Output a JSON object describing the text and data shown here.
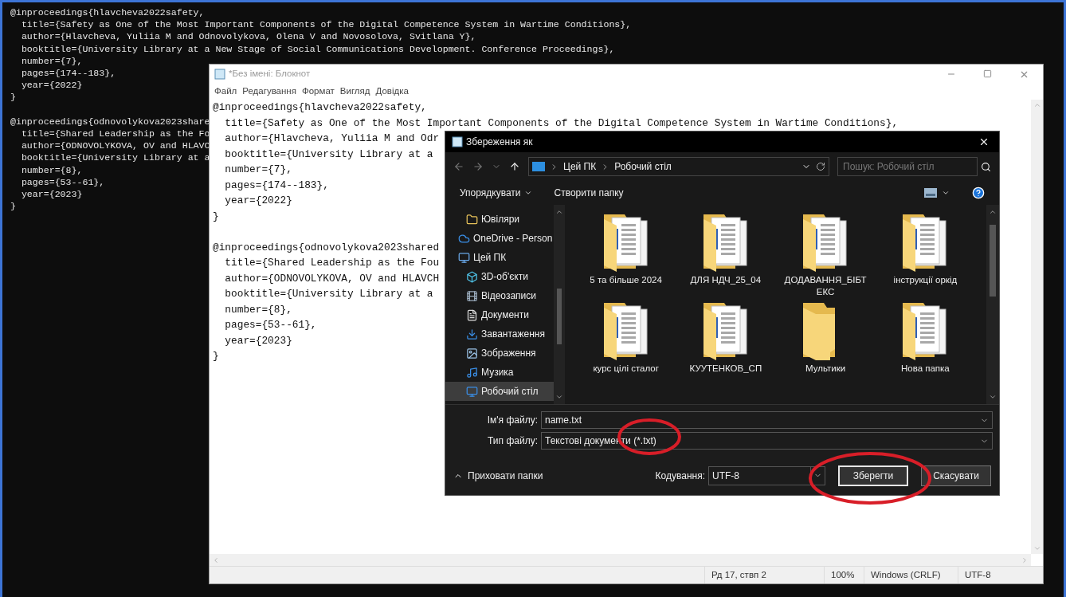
{
  "console": {
    "entries": [
      [
        "@inproceedings{hlavcheva2022safety,",
        "  title={Safety as One of the Most Important Components of the Digital Competence System in Wartime Conditions},",
        "  author={Hlavcheva, Yuliia M and Odnovolykova, Olena V and Novosolova, Svitlana Y},",
        "  booktitle={University Library at a New Stage of Social Communications Development. Conference Proceedings},",
        "  number={7},",
        "  pages={174--183},",
        "  year={2022}",
        "}"
      ],
      [
        "@inproceedings{odnovolykova2023share",
        "  title={Shared Leadership as the Fo",
        "  author={ODNOVOLYKOVA, OV and HLAVC",
        "  booktitle={University Library at a",
        "  number={8},",
        "  pages={53--61},",
        "  year={2023}",
        "}"
      ]
    ]
  },
  "notepad": {
    "title": "*Без імені: Блокнот",
    "menu": [
      "Файл",
      "Редагування",
      "Формат",
      "Вигляд",
      "Довідка"
    ],
    "entries": [
      [
        "@inproceedings{hlavcheva2022safety,",
        "  title={Safety as One of the Most Important Components of the Digital Competence System in Wartime Conditions},",
        "  author={Hlavcheva, Yuliia M and Odr",
        "  booktitle={University Library at a",
        "  number={7},",
        "  pages={174--183},",
        "  year={2022}",
        "}"
      ],
      [
        "@inproceedings{odnovolykova2023shared",
        "  title={Shared Leadership as the Fou",
        "  author={ODNOVOLYKOVA, OV and HLAVCH",
        "  booktitle={University Library at a",
        "  number={8},",
        "  pages={53--61},",
        "  year={2023}",
        "}"
      ]
    ],
    "status_bar": [
      "Рд 17, ствп 2",
      "100%",
      "Windows (CRLF)",
      "UTF-8"
    ]
  },
  "save_dialog": {
    "title": "Збереження як",
    "address": [
      "Цей ПК",
      "Робочий стіл"
    ],
    "search": {
      "placeholder": "Пошук: Робочий стіл"
    },
    "toolbar": [
      "Упорядкувати",
      "Створити папку"
    ],
    "nav": [
      {
        "label": "Ювіляри",
        "kind": "folder",
        "selected": false
      },
      {
        "label": "OneDrive - Person",
        "kind": "cloud",
        "selected": false
      },
      {
        "label": "Цей ПК",
        "kind": "pc",
        "selected": false,
        "children": [
          {
            "label": "3D-об'єкти",
            "kind": "objects",
            "selected": false
          },
          {
            "label": "Відеозаписи",
            "kind": "video",
            "selected": false
          },
          {
            "label": "Документи",
            "kind": "documents",
            "selected": false
          },
          {
            "label": "Завантаження",
            "kind": "downloads",
            "selected": false
          },
          {
            "label": "Зображення",
            "kind": "pictures",
            "selected": false
          },
          {
            "label": "Музика",
            "kind": "music",
            "selected": false
          },
          {
            "label": "Робочий стіл",
            "kind": "desktop",
            "selected": true
          }
        ]
      }
    ],
    "folders": [
      {
        "label": "5 та більше 2024",
        "kind": "documents"
      },
      {
        "label": "ДЛЯ НДЧ_25_04",
        "kind": "documents"
      },
      {
        "label": "ДОДАВАННЯ_БІБТЕКС",
        "kind": "documents"
      },
      {
        "label": "інструкції оркід",
        "kind": "documents"
      },
      {
        "label": "курс цілі сталог",
        "kind": "documents"
      },
      {
        "label": "КУУТЕНКОВ_СП",
        "kind": "documents"
      },
      {
        "label": "Мультики",
        "kind": "empty"
      },
      {
        "label": "Нова папка",
        "kind": "documents"
      }
    ],
    "file_name": {
      "label": "Ім'я файлу:",
      "value": "name.txt"
    },
    "file_type": {
      "label": "Тип файлу:",
      "value": "Текстові документи (*.txt)"
    },
    "hide_folders": "Приховати папки",
    "encoding": {
      "label": "Кодування:",
      "value": "UTF-8"
    },
    "buttons": [
      {
        "label": "Зберегти",
        "focused": true
      },
      {
        "label": "Скасувати",
        "focused": false
      }
    ]
  }
}
